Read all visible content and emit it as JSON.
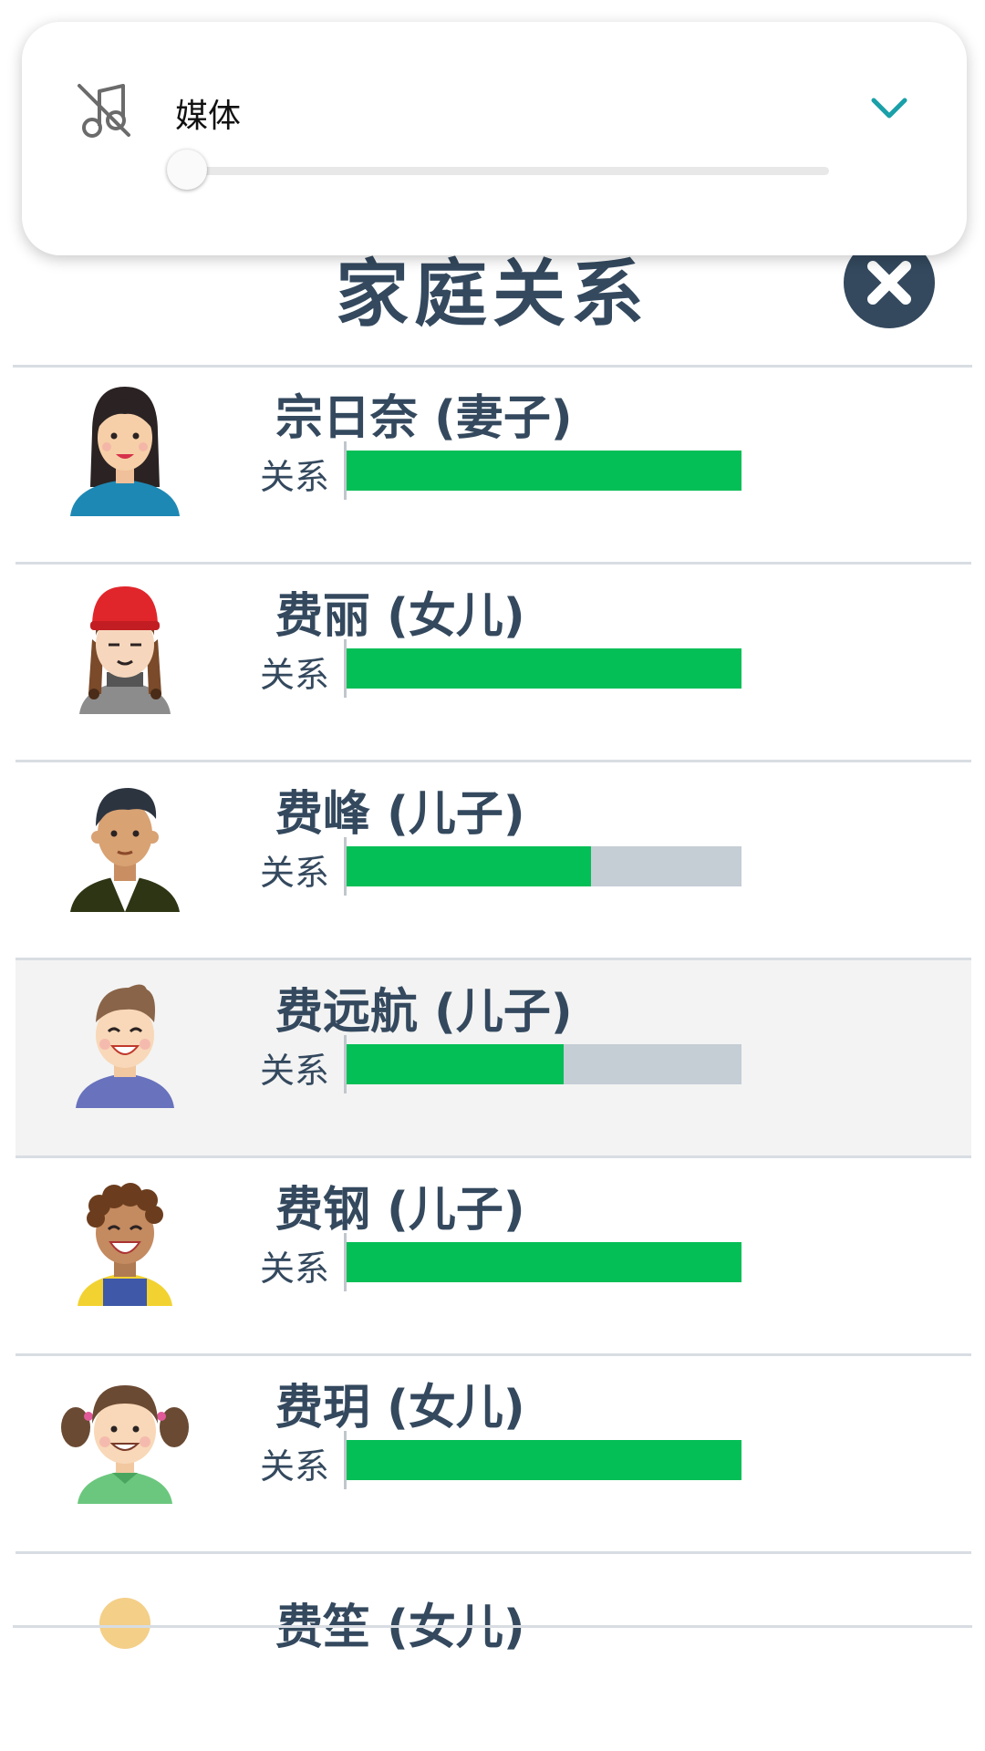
{
  "volume_panel": {
    "label": "媒体",
    "icon": "music-off-icon",
    "level": 0,
    "accent_color": "#1aa0a8"
  },
  "page": {
    "title": "家庭关系"
  },
  "family": [
    {
      "name": "宗日奈 (妻子)",
      "relation_label": "关系",
      "relationship": 1.0,
      "avatar": "wife-avatar"
    },
    {
      "name": "费丽 (女儿)",
      "relation_label": "关系",
      "relationship": 1.0,
      "avatar": "daughter-red-hat-avatar"
    },
    {
      "name": "费峰 (儿子)",
      "relation_label": "关系",
      "relationship": 0.62,
      "avatar": "son-dark-hair-avatar"
    },
    {
      "name": "费远航 (儿子)",
      "relation_label": "关系",
      "relationship": 0.55,
      "avatar": "son-smiling-avatar"
    },
    {
      "name": "费钢 (儿子)",
      "relation_label": "关系",
      "relationship": 1.0,
      "avatar": "son-curly-hair-avatar"
    },
    {
      "name": "费玥 (女儿)",
      "relation_label": "关系",
      "relationship": 1.0,
      "avatar": "daughter-pigtails-avatar"
    },
    {
      "name": "费笙 (女儿)",
      "avatar": "daughter-partial-avatar"
    }
  ],
  "colors": {
    "bar_fill": "#04be56",
    "bar_track": "#c5cdd5",
    "title": "#34495e"
  }
}
